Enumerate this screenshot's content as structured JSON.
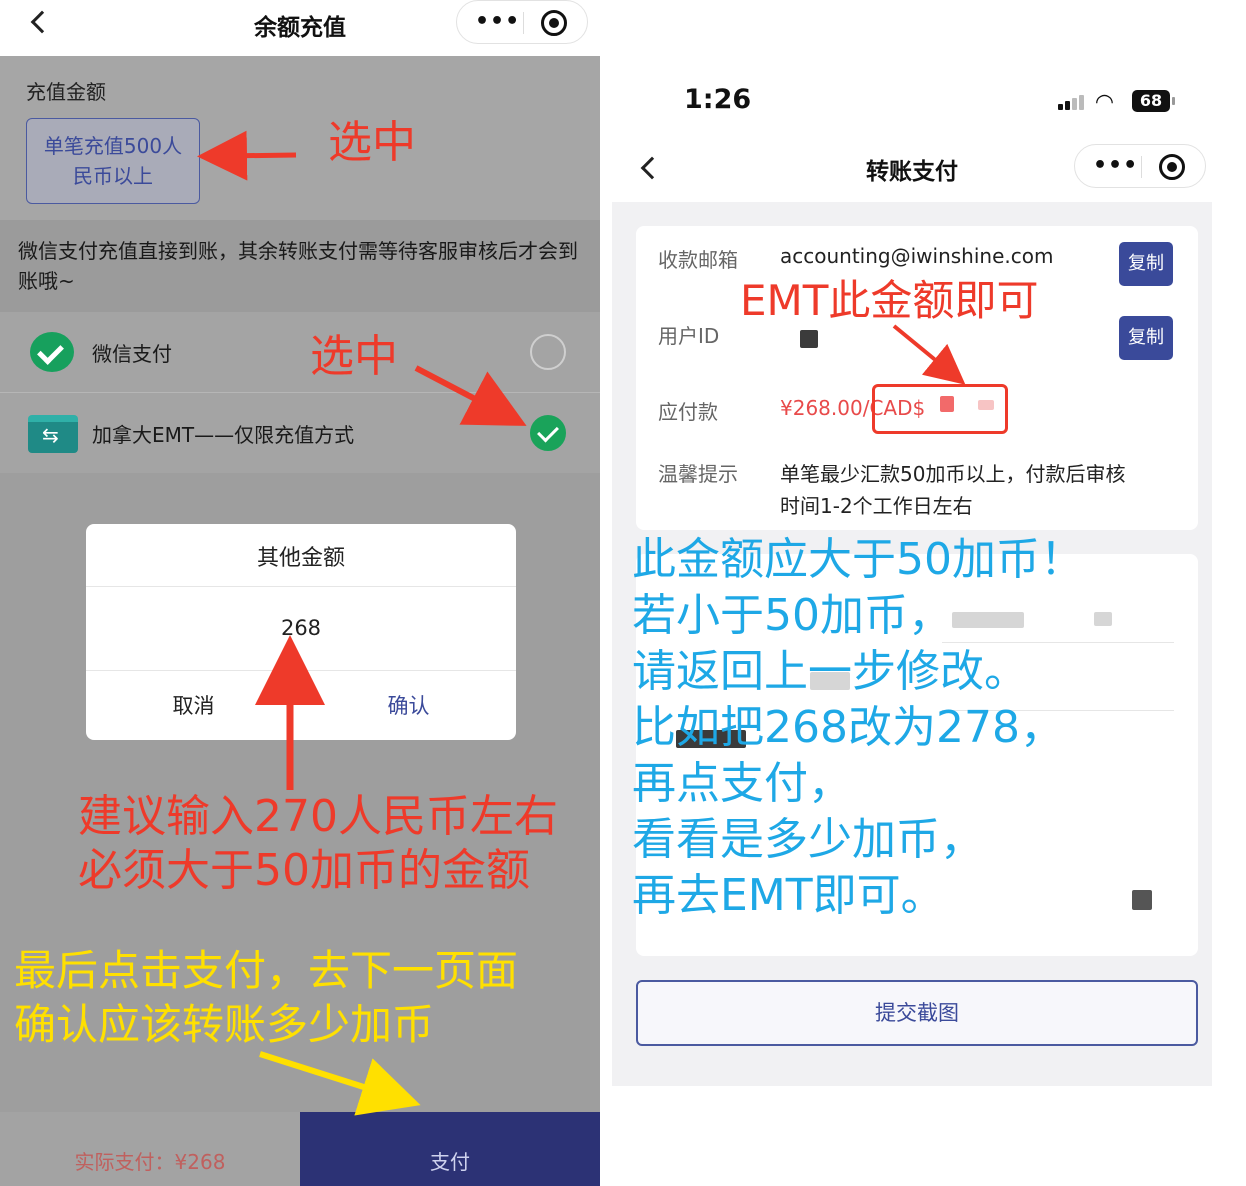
{
  "left_screen": {
    "nav": {
      "title": "余额充值",
      "more_icon": "more-dots-icon",
      "close_icon": "target-circle-icon"
    },
    "amount_section": {
      "label": "充值金额",
      "option_line1": "单笔充值500人",
      "option_line2": "民币以上"
    },
    "notice": "微信支付充值直接到账，其余转账支付需等待客服审核后才会到账哦~",
    "payment_methods": [
      {
        "label": "微信支付",
        "selected": false
      },
      {
        "label": "加拿大EMT——仅限充值方式",
        "selected": true
      }
    ],
    "dialog": {
      "title": "其他金额",
      "value": "268",
      "cancel": "取消",
      "confirm": "确认"
    },
    "footer": {
      "actual_pay": "实际支付：¥268",
      "pay_button": "支付"
    },
    "annotations": {
      "selected_1": "选中",
      "selected_2": "选中",
      "suggest_line1": "建议输入270人民币左右",
      "suggest_line2": "必须大于50加币的金额",
      "final_line1": "最后点击支付，去下一页面",
      "final_line2": "确认应该转账多少加币"
    }
  },
  "right_screen": {
    "status": {
      "time": "1:26",
      "battery": "68"
    },
    "nav": {
      "title": "转账支付"
    },
    "rows": {
      "email_label": "收款邮箱",
      "email_value": "accounting@iwinshine.com",
      "userid_label": "用户ID",
      "payable_label": "应付款",
      "payable_value": "¥268.00/CAD$",
      "tip_label": "温馨提示",
      "tip_line1": "单笔最少汇款50加币以上，付款后审核",
      "tip_line2": "时间1-2个工作日左右",
      "copy": "复制"
    },
    "submit": "提交截图",
    "annotations": {
      "emt_part1": "EMT此金额",
      "emt_part2": "即可",
      "blue_lines": [
        "此金额应大于50加币！",
        "若小于50加币，",
        "请返回上一步修改。",
        "比如把268改为278，",
        "再点支付，",
        "看看是多少加币，",
        "再去EMT即可。"
      ]
    }
  },
  "colors": {
    "accent": "#3a4a9a",
    "annotation_red": "#ee3a2a",
    "annotation_blue": "#1ea8e6",
    "annotation_yellow": "#ffe000",
    "wechat_green": "#1aa35a"
  }
}
